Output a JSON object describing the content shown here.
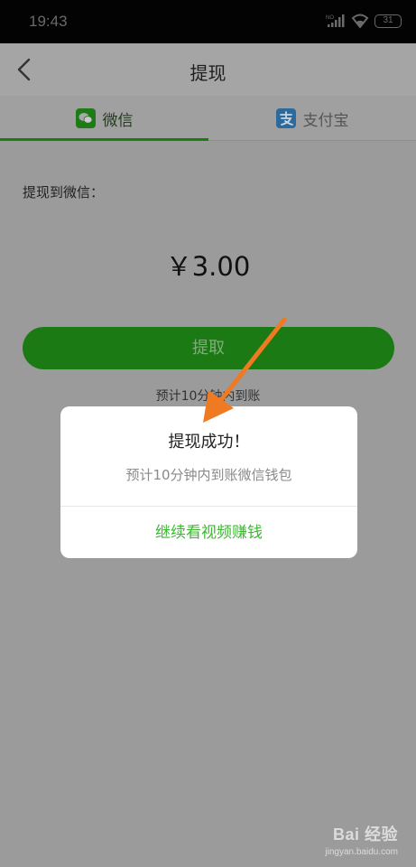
{
  "status_bar": {
    "time": "19:43",
    "network_label": "NO",
    "battery_level": "31",
    "icons": [
      "signal-icon",
      "wifi-icon",
      "battery-icon"
    ]
  },
  "nav": {
    "title": "提现",
    "back_icon": "chevron-left-icon"
  },
  "tabs": [
    {
      "label": "微信",
      "icon": "wechat-icon",
      "selected": true
    },
    {
      "label": "支付宝",
      "icon": "alipay-icon",
      "selected": false
    }
  ],
  "form": {
    "label_to": "提现到微信：",
    "amount": "￥3.00",
    "withdraw_label": "提取",
    "estimate_note": "预计10分钟内到账"
  },
  "dialog": {
    "title": "提现成功！",
    "message": "预计10分钟内到账微信钱包",
    "action_label": "继续看视频赚钱"
  },
  "watermark": {
    "logo_text": "Bai 经验",
    "url": "jingyan.baidu.com"
  },
  "colors": {
    "accent_green": "#3cb832",
    "button_green": "#1c7a15",
    "annotation_arrow": "#f07a22",
    "overlay": "#9b9b9b"
  }
}
